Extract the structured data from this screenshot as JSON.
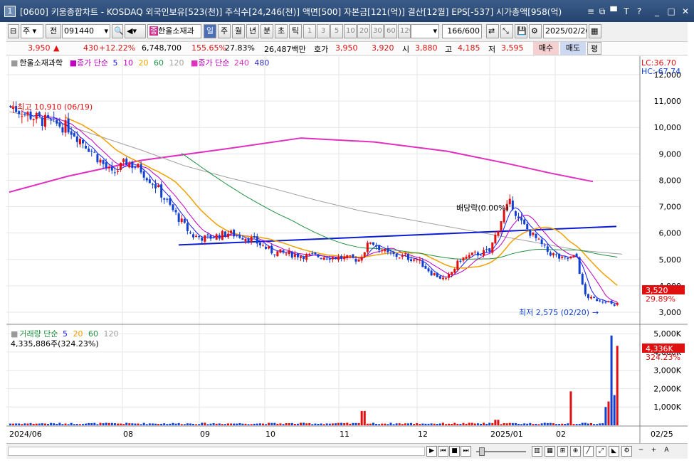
{
  "window": {
    "number": "1",
    "title": "[0600] 키움종합차트 - KOSDAQ 외국인보유[523(천)] 주식수[24,246(천)] 액면[500] 자본금[121(억)] 결산[12월] EPS[-537] 시가총액[958(억)"
  },
  "toolbar": {
    "period_type": "주",
    "prev_label": "전",
    "code": "091440",
    "stock_name": "한울소재과",
    "stock_badge": "종",
    "periods": [
      "일",
      "주",
      "월",
      "년",
      "분",
      "초",
      "틱"
    ],
    "active_period": "일",
    "minute_steps": [
      "1",
      "3",
      "5",
      "10",
      "20",
      "30",
      "60",
      "120"
    ],
    "count": "166/600",
    "date": "2025/02/26"
  },
  "quote": {
    "price": "3,950",
    "arrow": "▲",
    "change": "430",
    "change_pct": "+12.22%",
    "volume": "6,748,700",
    "volume_ratio": "155.65%",
    "turnover": "27.83%",
    "amount": "26,487백만",
    "bid_label": "호가",
    "ask": "3,950",
    "bid": "3,920",
    "open_label": "시",
    "open": "3,880",
    "high_label": "고",
    "high": "4,185",
    "low_label": "저",
    "low": "3,595",
    "buy_label": "매수",
    "sell_label": "매도",
    "avg_label": "평"
  },
  "price_legend": {
    "name": "한울소재과학",
    "ma_label": "종가 단순",
    "ma_periods": [
      "5",
      "10",
      "20",
      "60",
      "120"
    ],
    "ma_long_label": "종가 단순",
    "ma_long_periods": [
      "240",
      "480"
    ],
    "lc": "LC:36.70",
    "hc": "HC:-67.74"
  },
  "volume_legend": {
    "label": "거래량 단순",
    "periods": [
      "5",
      "20",
      "60",
      "120"
    ],
    "current": "4,335,886주(324.23%)"
  },
  "annotations": {
    "high": "최고 10,910 (06/19)",
    "low": "최저 2,575 (02/20)",
    "dividend": "배당락(0.00%)"
  },
  "price_axis": {
    "ticks": [
      "12,000",
      "11,000",
      "10,000",
      "9,000",
      "8,000",
      "7,000",
      "6,000",
      "5,000",
      "4,000",
      "3,000"
    ],
    "current_label": "3,520",
    "current_pct": "29.89%"
  },
  "volume_axis": {
    "ticks": [
      "5,000K",
      "4,000K",
      "3,000K",
      "2,000K",
      "1,000K"
    ],
    "current_label": "4,336K",
    "current_pct": "324.23%"
  },
  "x_axis": {
    "labels": [
      "2024/06",
      "08",
      "09",
      "10",
      "11",
      "12",
      "2025/01",
      "02",
      "02/25"
    ]
  },
  "colors": {
    "up": "#e01010",
    "down": "#1040d0",
    "ma5": "#1a1aff",
    "ma10": "#c000c0",
    "ma20": "#f0a000",
    "ma60": "#209040",
    "ma120": "#a0a0a0",
    "ma240": "#e030c0",
    "trend": "#0b1bd0"
  },
  "chart_data": {
    "type": "candlestick",
    "x_range": [
      "2024/06",
      "2025/02/26"
    ],
    "ylim": [
      2575,
      12200
    ],
    "volume_ylim": [
      0,
      5200000
    ],
    "ma240": [
      [
        0,
        7550
      ],
      [
        40,
        8150
      ],
      [
        90,
        8750
      ],
      [
        150,
        9200
      ],
      [
        200,
        9600
      ],
      [
        250,
        9450
      ],
      [
        300,
        9100
      ],
      [
        340,
        8650
      ],
      [
        370,
        8280
      ],
      [
        400,
        7950
      ]
    ],
    "ma120": [
      [
        0,
        10600
      ],
      [
        30,
        10250
      ],
      [
        60,
        9700
      ],
      [
        90,
        9150
      ],
      [
        120,
        8550
      ],
      [
        150,
        8100
      ],
      [
        180,
        7700
      ],
      [
        210,
        7250
      ],
      [
        240,
        6850
      ],
      [
        270,
        6550
      ],
      [
        300,
        6250
      ],
      [
        330,
        5950
      ],
      [
        360,
        5650
      ],
      [
        390,
        5350
      ],
      [
        420,
        5200
      ]
    ]
  }
}
